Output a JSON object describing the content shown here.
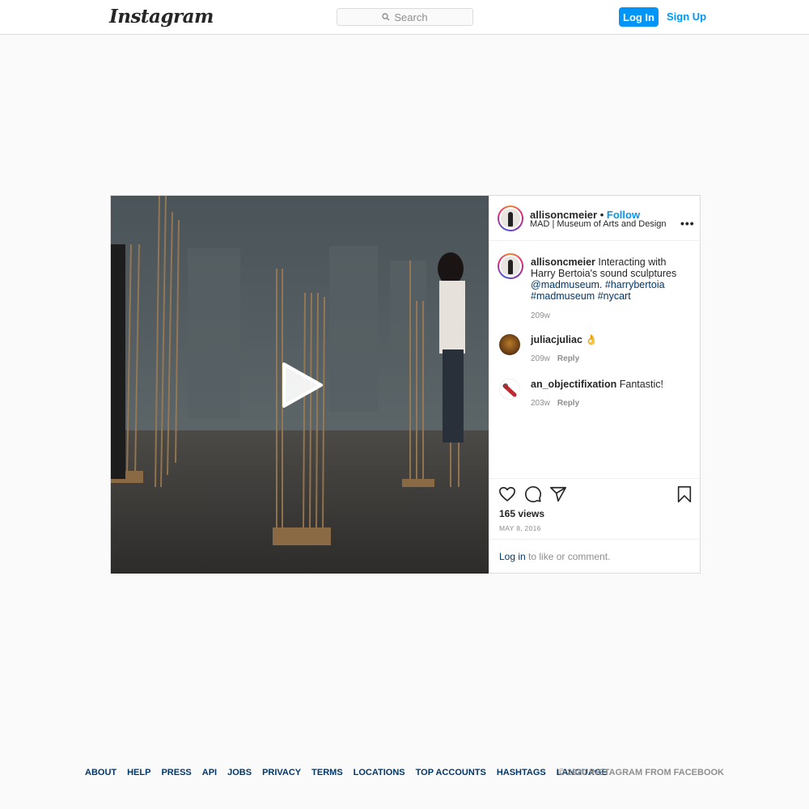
{
  "nav": {
    "logo": "Instagram",
    "search_placeholder": "Search",
    "login_label": "Log In",
    "signup_label": "Sign Up"
  },
  "post": {
    "username": "allisoncmeier",
    "dot": "•",
    "follow_label": "Follow",
    "location": "MAD | Museum of Arts and Design",
    "more_label": "•••",
    "caption": {
      "username": "allisoncmeier",
      "text": "Interacting with Harry Bertoia's sound sculptures",
      "mention": "@madmuseum.",
      "tags": [
        "#harrybertoia",
        "#madmuseum",
        "#nycart"
      ],
      "age": "209w"
    },
    "comments": [
      {
        "username": "juliacjuliac",
        "text": "👌",
        "age": "209w",
        "reply_label": "Reply"
      },
      {
        "username": "an_objectifixation",
        "text": "Fantastic!",
        "age": "203w",
        "reply_label": "Reply"
      }
    ],
    "views": "165 views",
    "date": "MAY 8, 2016",
    "login_link": "Log in",
    "login_suffix": "to like or comment.",
    "icons": [
      "heart-icon",
      "comment-icon",
      "share-icon",
      "bookmark-icon",
      "play-icon"
    ]
  },
  "footer": {
    "links": [
      "ABOUT",
      "HELP",
      "PRESS",
      "API",
      "JOBS",
      "PRIVACY",
      "TERMS",
      "LOCATIONS",
      "TOP ACCOUNTS",
      "HASHTAGS",
      "LANGUAGE"
    ],
    "copyright": "© 2020 INSTAGRAM FROM FACEBOOK"
  },
  "colors": {
    "accent": "#0095f6",
    "link": "#00376b",
    "muted": "#8e8e8e",
    "background": "#fafafa"
  }
}
